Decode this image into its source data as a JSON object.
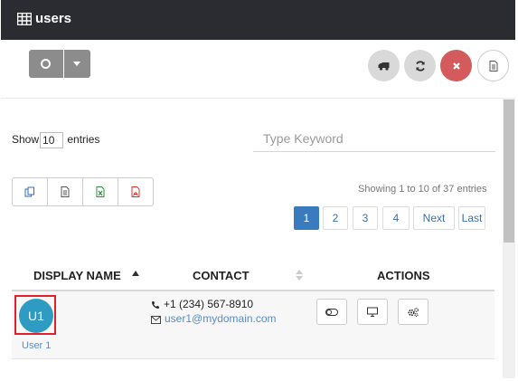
{
  "header": {
    "title": "users",
    "icon": "table-grid-icon"
  },
  "toolbar": {
    "split_button_icon": "circle-icon",
    "buttons": [
      {
        "name": "truck-icon",
        "color": "#d9d9d9"
      },
      {
        "name": "refresh-icon",
        "color": "#d9d9d9"
      },
      {
        "name": "close-icon",
        "color": "#d35b5b"
      },
      {
        "name": "document-icon",
        "color": "#ffffff"
      }
    ]
  },
  "controls": {
    "show_label": "Show",
    "entries_value": "10",
    "entries_label": "entries",
    "search_placeholder": "Type Keyword"
  },
  "export_buttons": [
    "copy-icon",
    "csv-icon",
    "excel-icon",
    "pdf-icon"
  ],
  "info": "Showing 1 to 10 of 37 entries",
  "pagination": {
    "pages": [
      "1",
      "2",
      "3",
      "4"
    ],
    "active": "1",
    "next": "Next",
    "last": "Last"
  },
  "table": {
    "columns": [
      "DISPLAY NAME",
      "CONTACT",
      "ACTIONS"
    ],
    "rows": [
      {
        "avatar": "U1",
        "name": "User 1",
        "phone": "+1 (234) 567-8910",
        "email": "user1@mydomain.com"
      }
    ]
  },
  "colors": {
    "accent": "#3a7bc0",
    "avatar": "#2e9cc2",
    "header_bg": "#2a2c31",
    "danger": "#d35b5b"
  }
}
